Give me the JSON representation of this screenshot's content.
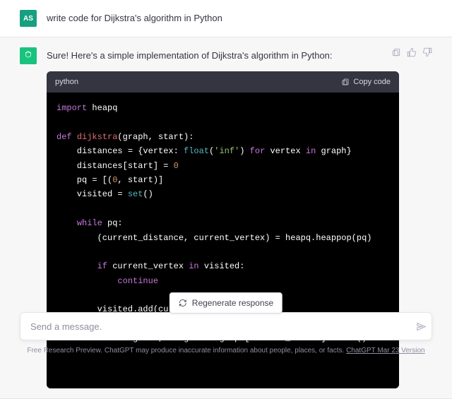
{
  "user": {
    "initials": "AS",
    "message": "write code for Dijkstra's algorithm in Python"
  },
  "assistant": {
    "intro": "Sure! Here's a simple implementation of Dijkstra's algorithm in Python:",
    "code_lang": "python",
    "copy_label": "Copy code",
    "code_tokens": [
      [
        [
          "kw-import",
          "import"
        ],
        [
          "",
          " heapq"
        ]
      ],
      [],
      [
        [
          "kw-def",
          "def"
        ],
        [
          "",
          " "
        ],
        [
          "fn-name",
          "dijkstra"
        ],
        [
          "",
          "(graph, start):"
        ]
      ],
      [
        [
          "",
          "    distances = {vertex: "
        ],
        [
          "builtin",
          "float"
        ],
        [
          "",
          "("
        ],
        [
          "string",
          "'inf'"
        ],
        [
          "",
          ") "
        ],
        [
          "kw-flow",
          "for"
        ],
        [
          "",
          " vertex "
        ],
        [
          "kw-in",
          "in"
        ],
        [
          "",
          " graph}"
        ]
      ],
      [
        [
          "",
          "    distances[start] = "
        ],
        [
          "num",
          "0"
        ]
      ],
      [
        [
          "",
          "    pq = [("
        ],
        [
          "num",
          "0"
        ],
        [
          "",
          ", start)]"
        ]
      ],
      [
        [
          "",
          "    visited = "
        ],
        [
          "builtin",
          "set"
        ],
        [
          "",
          "()"
        ]
      ],
      [],
      [
        [
          "",
          "    "
        ],
        [
          "kw-flow",
          "while"
        ],
        [
          "",
          " pq:"
        ]
      ],
      [
        [
          "",
          "        (current_distance, current_vertex) = heapq.heappop(pq)"
        ]
      ],
      [],
      [
        [
          "",
          "        "
        ],
        [
          "kw-flow",
          "if"
        ],
        [
          "",
          " current_vertex "
        ],
        [
          "kw-in",
          "in"
        ],
        [
          "",
          " visited:"
        ]
      ],
      [
        [
          "",
          "            "
        ],
        [
          "kw-flow",
          "continue"
        ]
      ],
      [],
      [
        [
          "",
          "        visited.add(current_vertex)"
        ]
      ],
      [],
      [
        [
          "",
          "        "
        ],
        [
          "kw-flow",
          "for"
        ],
        [
          "",
          " neighbor, weight in graph[current_vertex].items():"
        ]
      ]
    ]
  },
  "regen_label": "Regenerate response",
  "input_placeholder": "Send a message.",
  "footer_text": "Free Research Preview. ChatGPT may produce inaccurate information about people, places, or facts. ",
  "footer_link": "ChatGPT Mar 23 Version"
}
